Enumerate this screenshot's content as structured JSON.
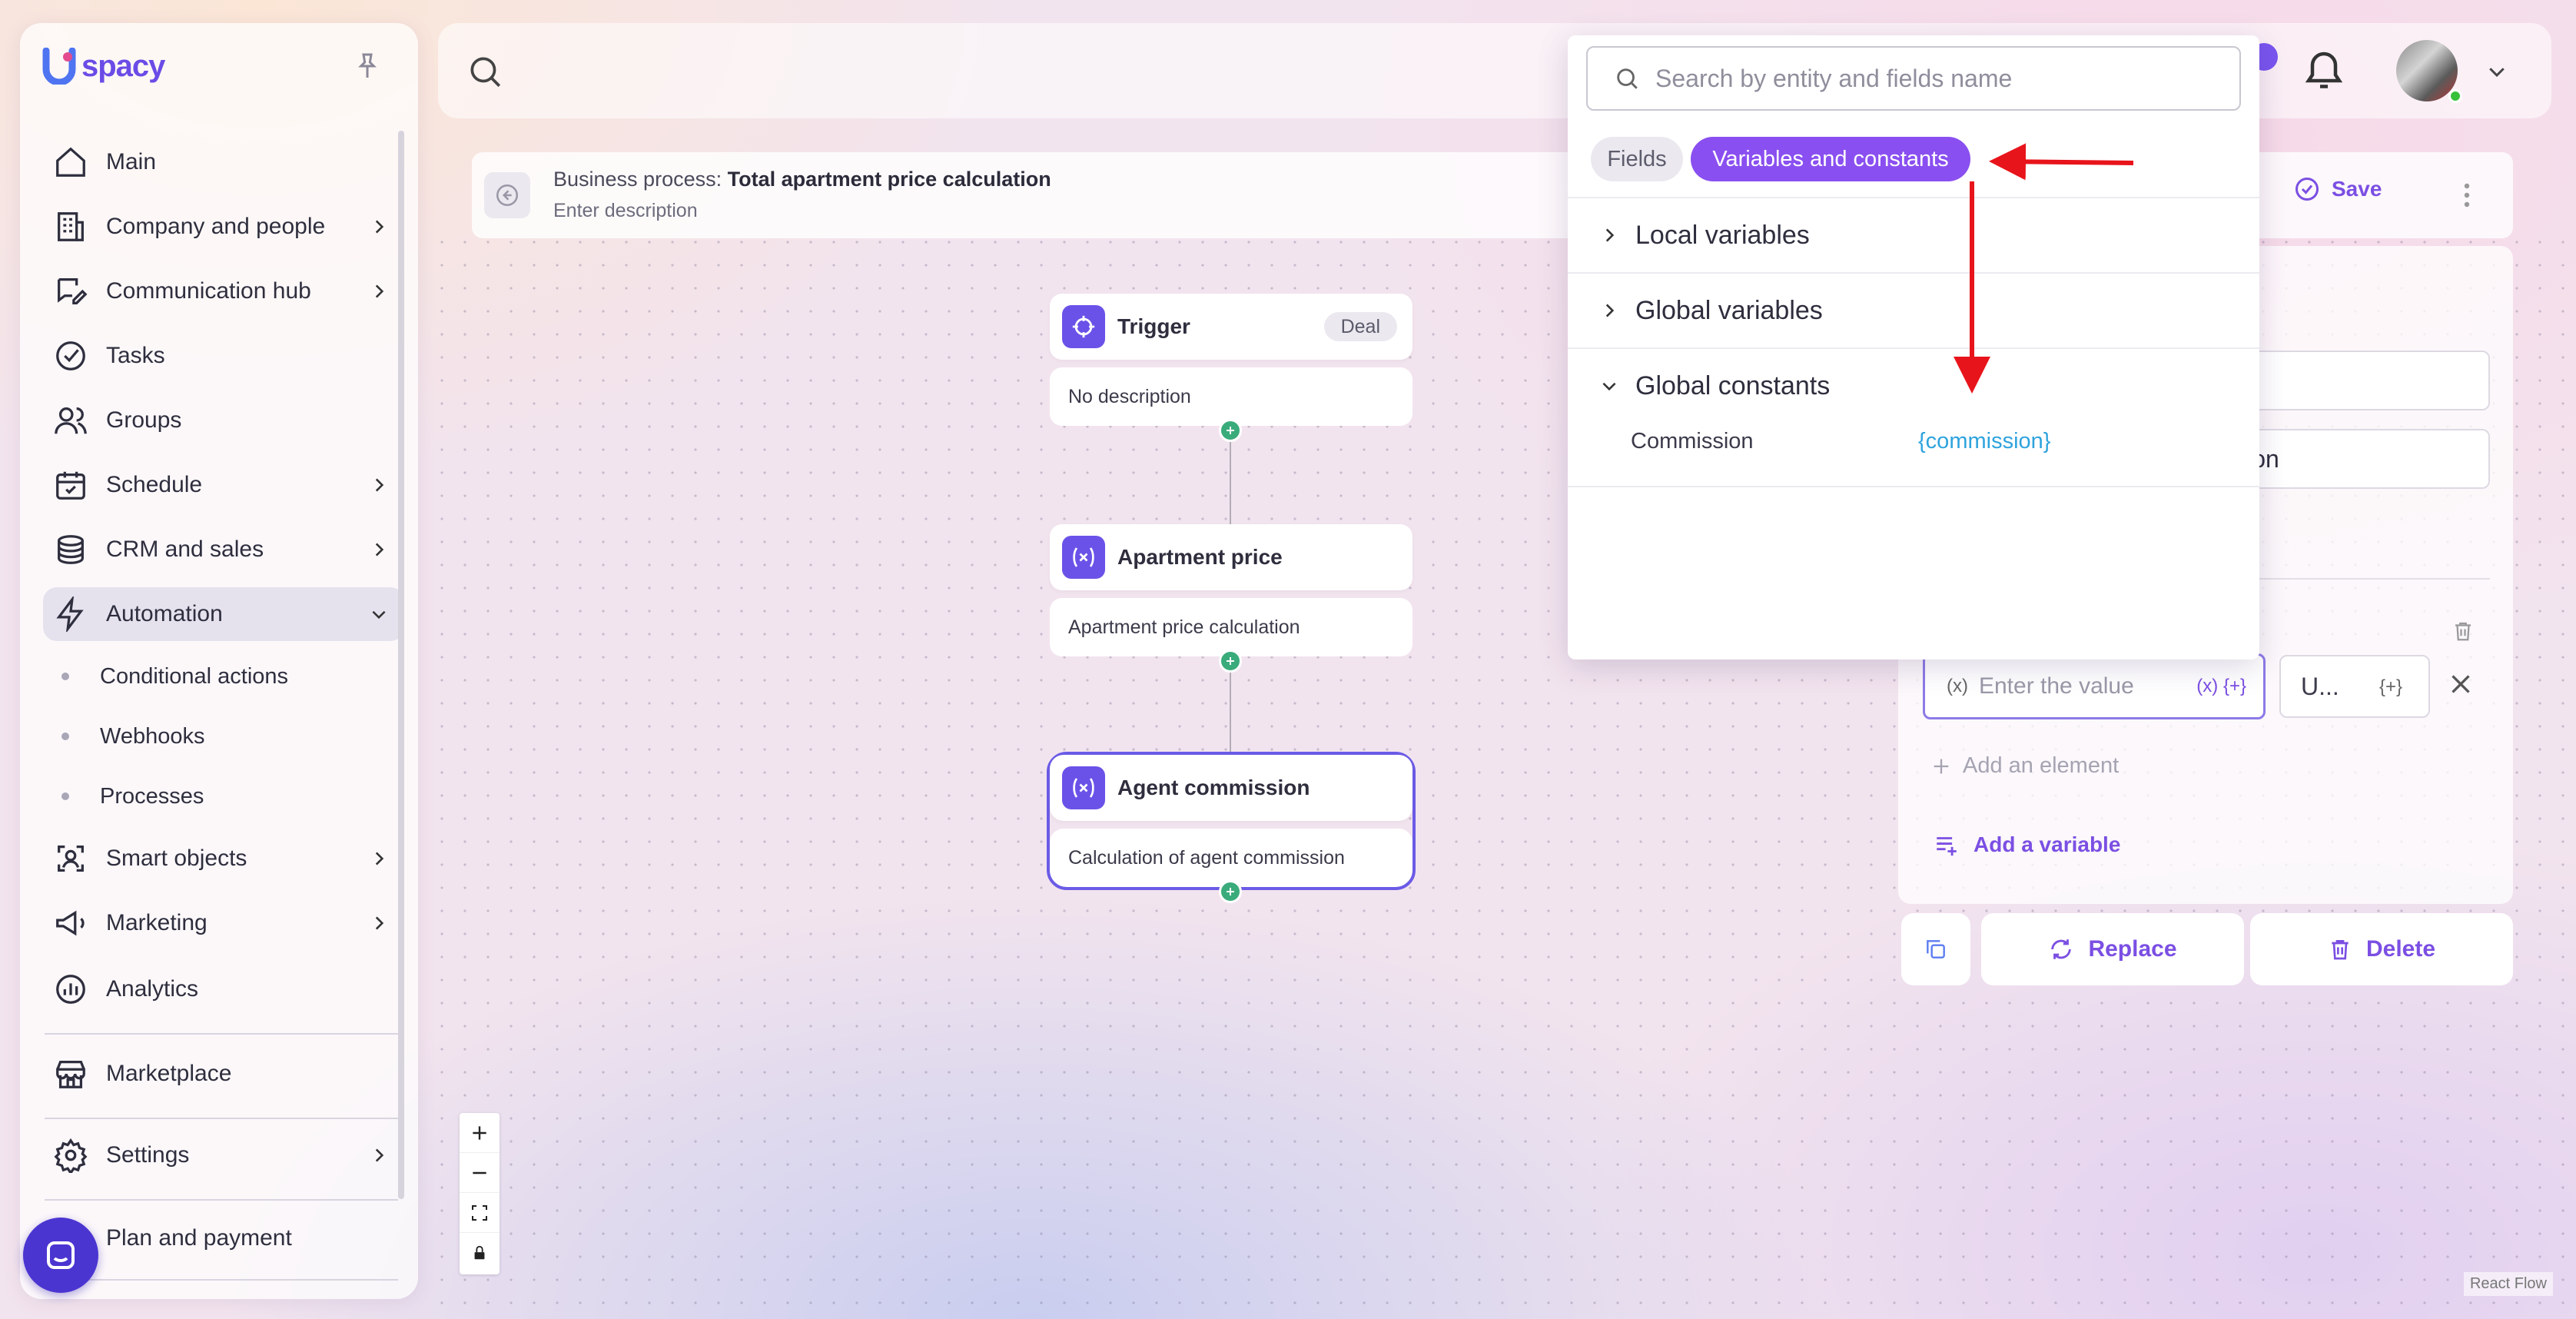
{
  "app": {
    "logo_text": "spacy"
  },
  "sidebar": {
    "items": [
      {
        "label": "Main",
        "icon": "home-icon"
      },
      {
        "label": "Company and people",
        "icon": "building-icon"
      },
      {
        "label": "Communication hub",
        "icon": "chat-edit-icon"
      },
      {
        "label": "Tasks",
        "icon": "check-circle-icon"
      },
      {
        "label": "Groups",
        "icon": "users-icon"
      },
      {
        "label": "Schedule",
        "icon": "calendar-icon"
      },
      {
        "label": "CRM and sales",
        "icon": "coins-icon"
      },
      {
        "label": "Automation",
        "icon": "lightning-icon"
      },
      {
        "label": "Smart objects",
        "icon": "smart-object-icon"
      },
      {
        "label": "Marketing",
        "icon": "megaphone-icon"
      },
      {
        "label": "Analytics",
        "icon": "chart-icon"
      },
      {
        "label": "Marketplace",
        "icon": "store-icon"
      },
      {
        "label": "Settings",
        "icon": "gear-icon"
      },
      {
        "label": "Plan and payment",
        "icon": "card-icon"
      }
    ],
    "automation_sub": [
      "Conditional actions",
      "Webhooks",
      "Processes"
    ]
  },
  "process": {
    "prefix": "Business process:",
    "name": "Total apartment price calculation",
    "description_placeholder": "Enter description"
  },
  "toolbar": {
    "save_label": "Save"
  },
  "nodes": [
    {
      "title": "Trigger",
      "tag": "Deal",
      "body": "No description"
    },
    {
      "title": "Apartment price",
      "body": "Apartment price calculation"
    },
    {
      "title": "Agent commission",
      "body": "Calculation of agent commission"
    }
  ],
  "right_panel": {
    "field2_value": "ission",
    "value_placeholder": "Enter the value",
    "value_prefix": "(x)",
    "value_suffix": "(x) {+}",
    "unit_value": "U...",
    "unit_suffix": "{+}",
    "add_element": "Add an element",
    "add_variable": "Add a variable",
    "replace": "Replace",
    "delete": "Delete"
  },
  "dropdown": {
    "search_placeholder": "Search by entity and fields name",
    "tabs": [
      "Fields",
      "Variables and constants"
    ],
    "active_tab": "Variables and constants",
    "sections": [
      {
        "label": "Local variables",
        "expanded": false
      },
      {
        "label": "Global variables",
        "expanded": false
      },
      {
        "label": "Global constants",
        "expanded": true
      }
    ],
    "constants": [
      {
        "name": "Commission",
        "value": "{commission}"
      }
    ]
  },
  "footer": {
    "react_flow": "React Flow"
  },
  "colors": {
    "accent": "#8a4ff0",
    "node_icon": "#6a52e8",
    "handle": "#3aab7b",
    "constant_value": "#2ea3dd",
    "annotation_arrow": "#e8141b"
  }
}
